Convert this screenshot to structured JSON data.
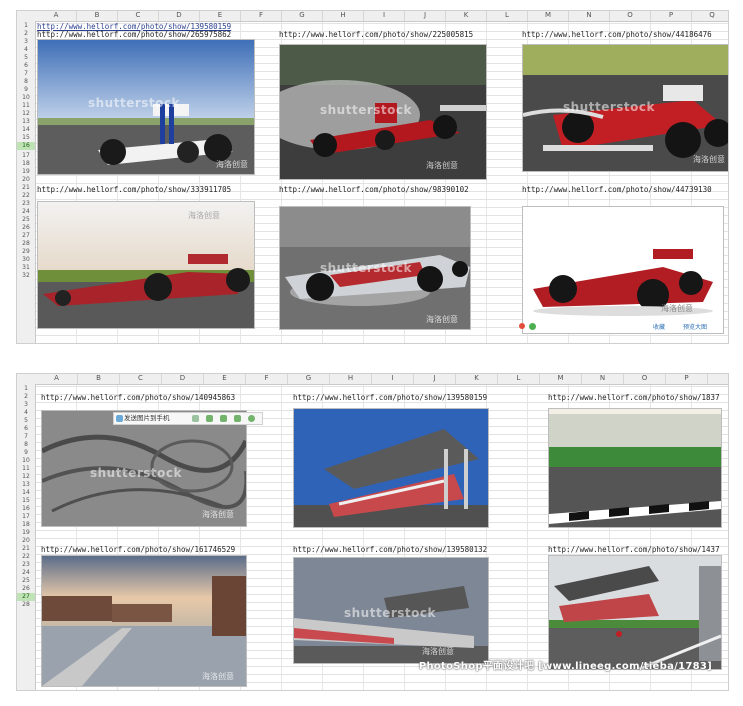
{
  "panel1": {
    "columns": [
      "A",
      "B",
      "C",
      "D",
      "E",
      "F",
      "G",
      "H",
      "I",
      "J",
      "K",
      "L",
      "M",
      "N",
      "O",
      "P",
      "Q"
    ],
    "rows": [
      "1",
      "2",
      "3",
      "4",
      "5",
      "6",
      "7",
      "8",
      "9",
      "10",
      "11",
      "12",
      "13",
      "14",
      "15",
      "16",
      "17",
      "18",
      "19",
      "20",
      "21",
      "22",
      "23",
      "24",
      "25",
      "26",
      "27",
      "28",
      "29",
      "30",
      "31",
      "32"
    ],
    "urls": [
      "http://www.hellorf.com/photo/show/139580159",
      "http://www.hellorf.com/photo/show/265975862",
      "http://www.hellorf.com/photo/show/225005815",
      "http://www.hellorf.com/photo/show/44186476",
      "http://www.hellorf.com/photo/show/333911705",
      "http://www.hellorf.com/photo/show/98390102",
      "http://www.hellorf.com/photo/show/44739130"
    ],
    "watermark": "shutterstock",
    "watermark_cn": "海洛创意",
    "action_share": "收藏",
    "action_preview": "预览大图"
  },
  "panel2": {
    "columns": [
      "A",
      "B",
      "C",
      "D",
      "E",
      "F",
      "G",
      "H",
      "I",
      "J",
      "K",
      "L",
      "M",
      "N",
      "O",
      "P"
    ],
    "rows": [
      "1",
      "2",
      "3",
      "4",
      "5",
      "6",
      "7",
      "8",
      "9",
      "10",
      "11",
      "12",
      "13",
      "14",
      "15",
      "16",
      "17",
      "18",
      "19",
      "20",
      "21",
      "22",
      "23",
      "24",
      "25",
      "26",
      "27",
      "28"
    ],
    "urls": [
      "http://www.hellorf.com/photo/show/140945863",
      "http://www.hellorf.com/photo/show/139580159",
      "http://www.hellorf.com/photo/show/1837",
      "http://www.hellorf.com/photo/show/161746529",
      "http://www.hellorf.com/photo/show/139580132",
      "http://www.hellorf.com/photo/show/1437"
    ],
    "toolbar_label": "发送图片到手机",
    "watermark": "shutterstock",
    "watermark_cn": "海洛创意"
  },
  "caption": "PhotoShop平面设计吧 [www.lineeg.com/tieba/1783]",
  "colors": {
    "header_bg": "#efefef",
    "grid": "#e3e3e3",
    "selected_row": "#bfe3b4"
  }
}
